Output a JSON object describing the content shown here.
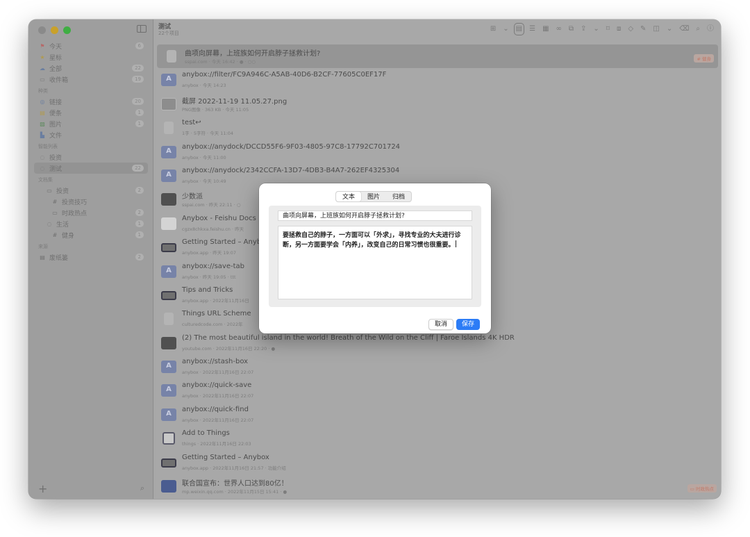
{
  "sidebar": {
    "items": [
      {
        "icon": "⚑",
        "label": "今天",
        "count": "6",
        "icon_color": "#b56a6a"
      },
      {
        "icon": "★",
        "label": "星标",
        "count": "",
        "icon_color": "#b09a50"
      },
      {
        "icon": "☁",
        "label": "全部",
        "count": "22",
        "icon_color": "#6a7ea0"
      },
      {
        "icon": "▭",
        "label": "收件箱",
        "count": "19",
        "icon_color": "#7a7a7a"
      }
    ],
    "types_header": "种类",
    "types": [
      {
        "icon": "◎",
        "label": "链接",
        "count": "20",
        "icon_color": "#6a7ea0"
      },
      {
        "icon": "▤",
        "label": "便条",
        "count": "1",
        "icon_color": "#b09a50"
      },
      {
        "icon": "▨",
        "label": "图片",
        "count": "1",
        "icon_color": "#5e8a5e"
      },
      {
        "icon": "▙",
        "label": "文件",
        "count": "",
        "icon_color": "#6a7ea0"
      }
    ],
    "smart_header": "智能列表",
    "smart": [
      {
        "icon": "◌",
        "label": "投资",
        "count": "",
        "icon_color": "#7a7a7a"
      },
      {
        "icon": "◌",
        "label": "测试",
        "count": "22",
        "icon_color": "#7a7a7a"
      }
    ],
    "collections_header": "文档集",
    "collections": [
      {
        "icon": "▭",
        "label": "投资",
        "count": "2",
        "level": 1
      },
      {
        "icon": "#",
        "label": "投资技巧",
        "count": "",
        "level": 2
      },
      {
        "icon": "▭",
        "label": "时政热点",
        "count": "2",
        "level": 2
      },
      {
        "icon": "◌",
        "label": "生活",
        "count": "1",
        "level": 1
      },
      {
        "icon": "#",
        "label": "健身",
        "count": "1",
        "level": 2
      }
    ],
    "sources_header": "来源",
    "sources": [
      {
        "icon": "▤",
        "label": "废纸篓",
        "count": "2"
      }
    ]
  },
  "main": {
    "title": "测试",
    "subtitle": "22个项目",
    "rows": [
      {
        "title": "曲项向屏幕，上班族如何开启脖子拯救计划?",
        "meta": "sspai.com · 今天 16:42 · ● · ○○",
        "thumb": "t-doc",
        "tag": "# 健身",
        "selected": true
      },
      {
        "title": "anybox://filter/FC9A946C-A5AB-40D6-B2CF-77605C0EF17F",
        "meta": "anybox · 今天 14:23",
        "thumb": "t-anybox",
        "tag": ""
      },
      {
        "title": "截屏 2022-11-19 11.05.27.png",
        "meta": "PNG图像 · 363 KB · 今天 11:05",
        "thumb": "t-img",
        "tag": ""
      },
      {
        "title": "test↩",
        "meta": "1字 · 5字符 · 今天 11:04",
        "thumb": "t-doc",
        "tag": ""
      },
      {
        "title": "anybox://anydock/DCCD55F6-9F03-4805-97C8-17792C701724",
        "meta": "anybox · 今天 11:00",
        "thumb": "t-anybox",
        "tag": ""
      },
      {
        "title": "anybox://anydock/2342CCFA-13D7-4DB3-B4A7-262EF4325304",
        "meta": "anybox · 今天 10:49",
        "thumb": "t-anybox",
        "tag": ""
      },
      {
        "title": "少数派",
        "meta": "sspai.com · 昨天 22:11 · ○",
        "thumb": "t-dark",
        "tag": ""
      },
      {
        "title": "Anybox - Feishu Docs",
        "meta": "cgzx8chkxa.feishu.cn · 昨天",
        "thumb": "t-white",
        "tag": ""
      },
      {
        "title": "Getting Started – Anybox",
        "meta": "anybox.app · 昨天 19:07",
        "thumb": "t-screen",
        "tag": ""
      },
      {
        "title": "anybox://save-tab",
        "meta": "anybox · 昨天 19:05 · ttt",
        "thumb": "t-anybox",
        "tag": ""
      },
      {
        "title": "Tips and Tricks",
        "meta": "anybox.app · 2022年11月16日",
        "thumb": "t-screen",
        "tag": ""
      },
      {
        "title": "Things URL Scheme",
        "meta": "culturedcode.com · 2022年",
        "thumb": "t-doc",
        "tag": ""
      },
      {
        "title": "(2) The most beautiful island in the world! Breath of the Wild on the Cliff | Faroe Islands 4K HDR",
        "meta": "youtube.com · 2022年11月16日 22:20 · ●",
        "thumb": "t-dark",
        "tag": ""
      },
      {
        "title": "anybox://stash-box",
        "meta": "anybox · 2022年11月16日 22:07",
        "thumb": "t-anybox",
        "tag": ""
      },
      {
        "title": "anybox://quick-save",
        "meta": "anybox · 2022年11月16日 22:07",
        "thumb": "t-anybox",
        "tag": ""
      },
      {
        "title": "anybox://quick-find",
        "meta": "anybox · 2022年11月16日 22:07",
        "thumb": "t-anybox",
        "tag": ""
      },
      {
        "title": "Add to Things",
        "meta": "things · 2022年11月16日 22:03",
        "thumb": "t-check",
        "tag": ""
      },
      {
        "title": "Getting Started – Anybox",
        "meta": "anybox.app · 2022年11月16日 21:57 · 功能介绍",
        "thumb": "t-screen",
        "tag": ""
      },
      {
        "title": "联合国宣布：世界人口达到80亿！",
        "meta": "mp.weixin.qq.com · 2022年11月15日 15:41 · ●",
        "thumb": "t-blue",
        "tag": "▭ 时政热点"
      }
    ]
  },
  "toolbar_icons": [
    "grid-view-icon",
    "chevron-down-icon",
    "card-view-icon",
    "list-view-icon",
    "table-view-icon",
    "glasses-icon",
    "copy-icon",
    "share-icon",
    "chevron-down-icon",
    "bookmark-icon",
    "open-icon",
    "tag-icon",
    "note-icon",
    "panel-icon",
    "chevron-down-icon",
    "trash-icon",
    "search-icon",
    "info-icon"
  ],
  "dialog": {
    "tabs": [
      "文本",
      "图片",
      "归档"
    ],
    "active_tab": 0,
    "title_value": "曲项向屏幕，上班族如何开启脖子拯救计划?",
    "body_value": "要拯救自己的脖子，一方面可以「外求」，寻找专业的大夫进行诊断，另一方面要学会「内养」，改变自己的日常习惯也很重要。",
    "cancel_label": "取消",
    "save_label": "保存",
    "accent": "#2c7cf6"
  },
  "colors": {
    "traffic_red": "#8a8a8a",
    "traffic_yellow": "#c9a12a",
    "traffic_green": "#3fae43"
  }
}
